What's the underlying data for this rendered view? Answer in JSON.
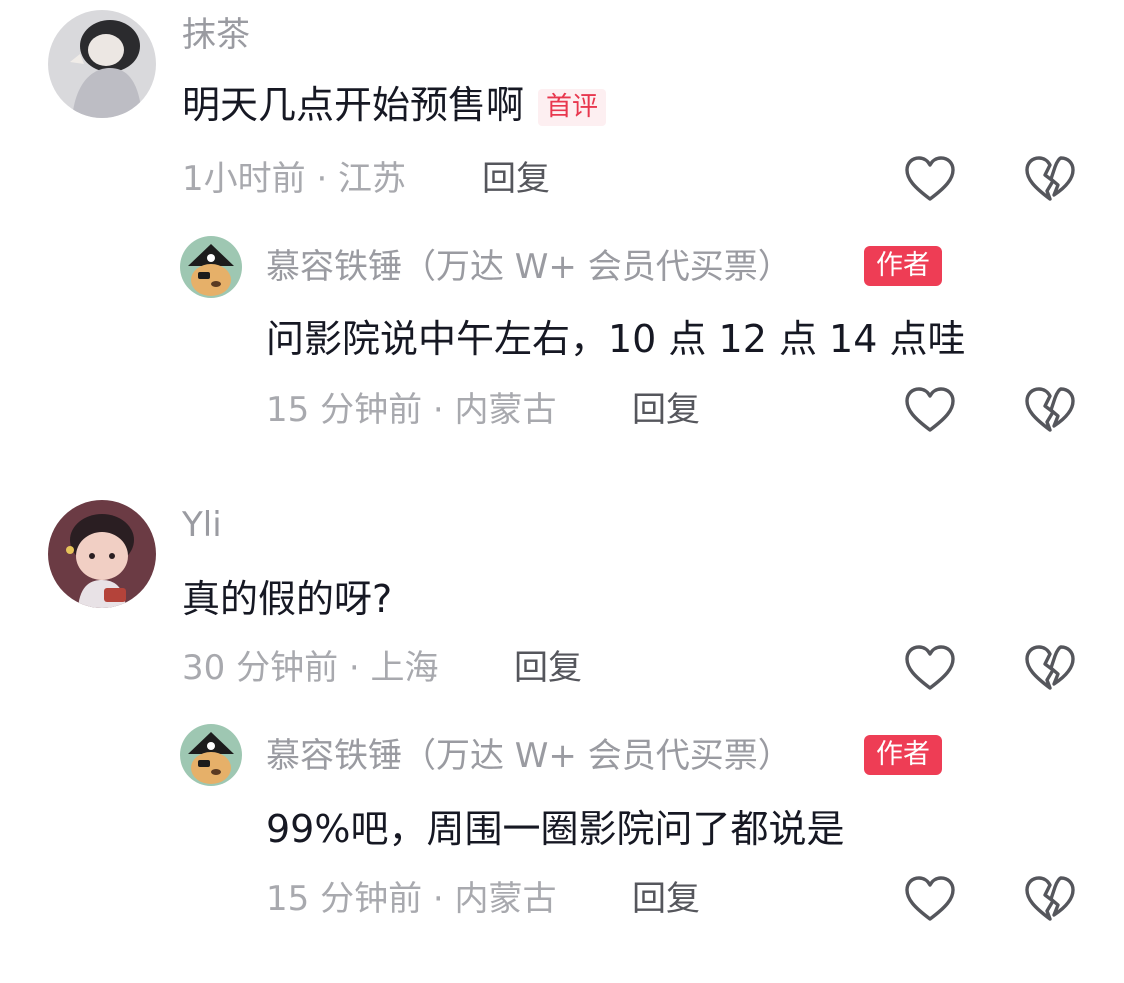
{
  "comments": [
    {
      "user": "抹茶",
      "text": "明天几点开始预售啊",
      "tag": "首评",
      "time": "1小时前 · 江苏",
      "reply_label": "回复",
      "reply": {
        "user": "慕容铁锤（万达 W+ 会员代买票）",
        "badge": "作者",
        "text": "问影院说中午左右，10 点 12 点 14 点哇",
        "time": "15 分钟前 · 内蒙古",
        "reply_label": "回复"
      }
    },
    {
      "user": "Yli",
      "text": "真的假的呀?",
      "time": "30 分钟前 · 上海",
      "reply_label": "回复",
      "reply": {
        "user": "慕容铁锤（万达 W+ 会员代买票）",
        "badge": "作者",
        "text": "99%吧，周围一圈影院问了都说是",
        "time": "15 分钟前 · 内蒙古",
        "reply_label": "回复"
      }
    }
  ],
  "icons": {
    "like": "heart-outline-icon",
    "dislike": "broken-heart-icon"
  },
  "colors": {
    "author_badge": "#ee3d55",
    "first_tag_text": "#e8374e",
    "first_tag_bg": "#fdeff1",
    "meta_text": "#a8a9ae",
    "username_text": "#9a9ba1"
  }
}
